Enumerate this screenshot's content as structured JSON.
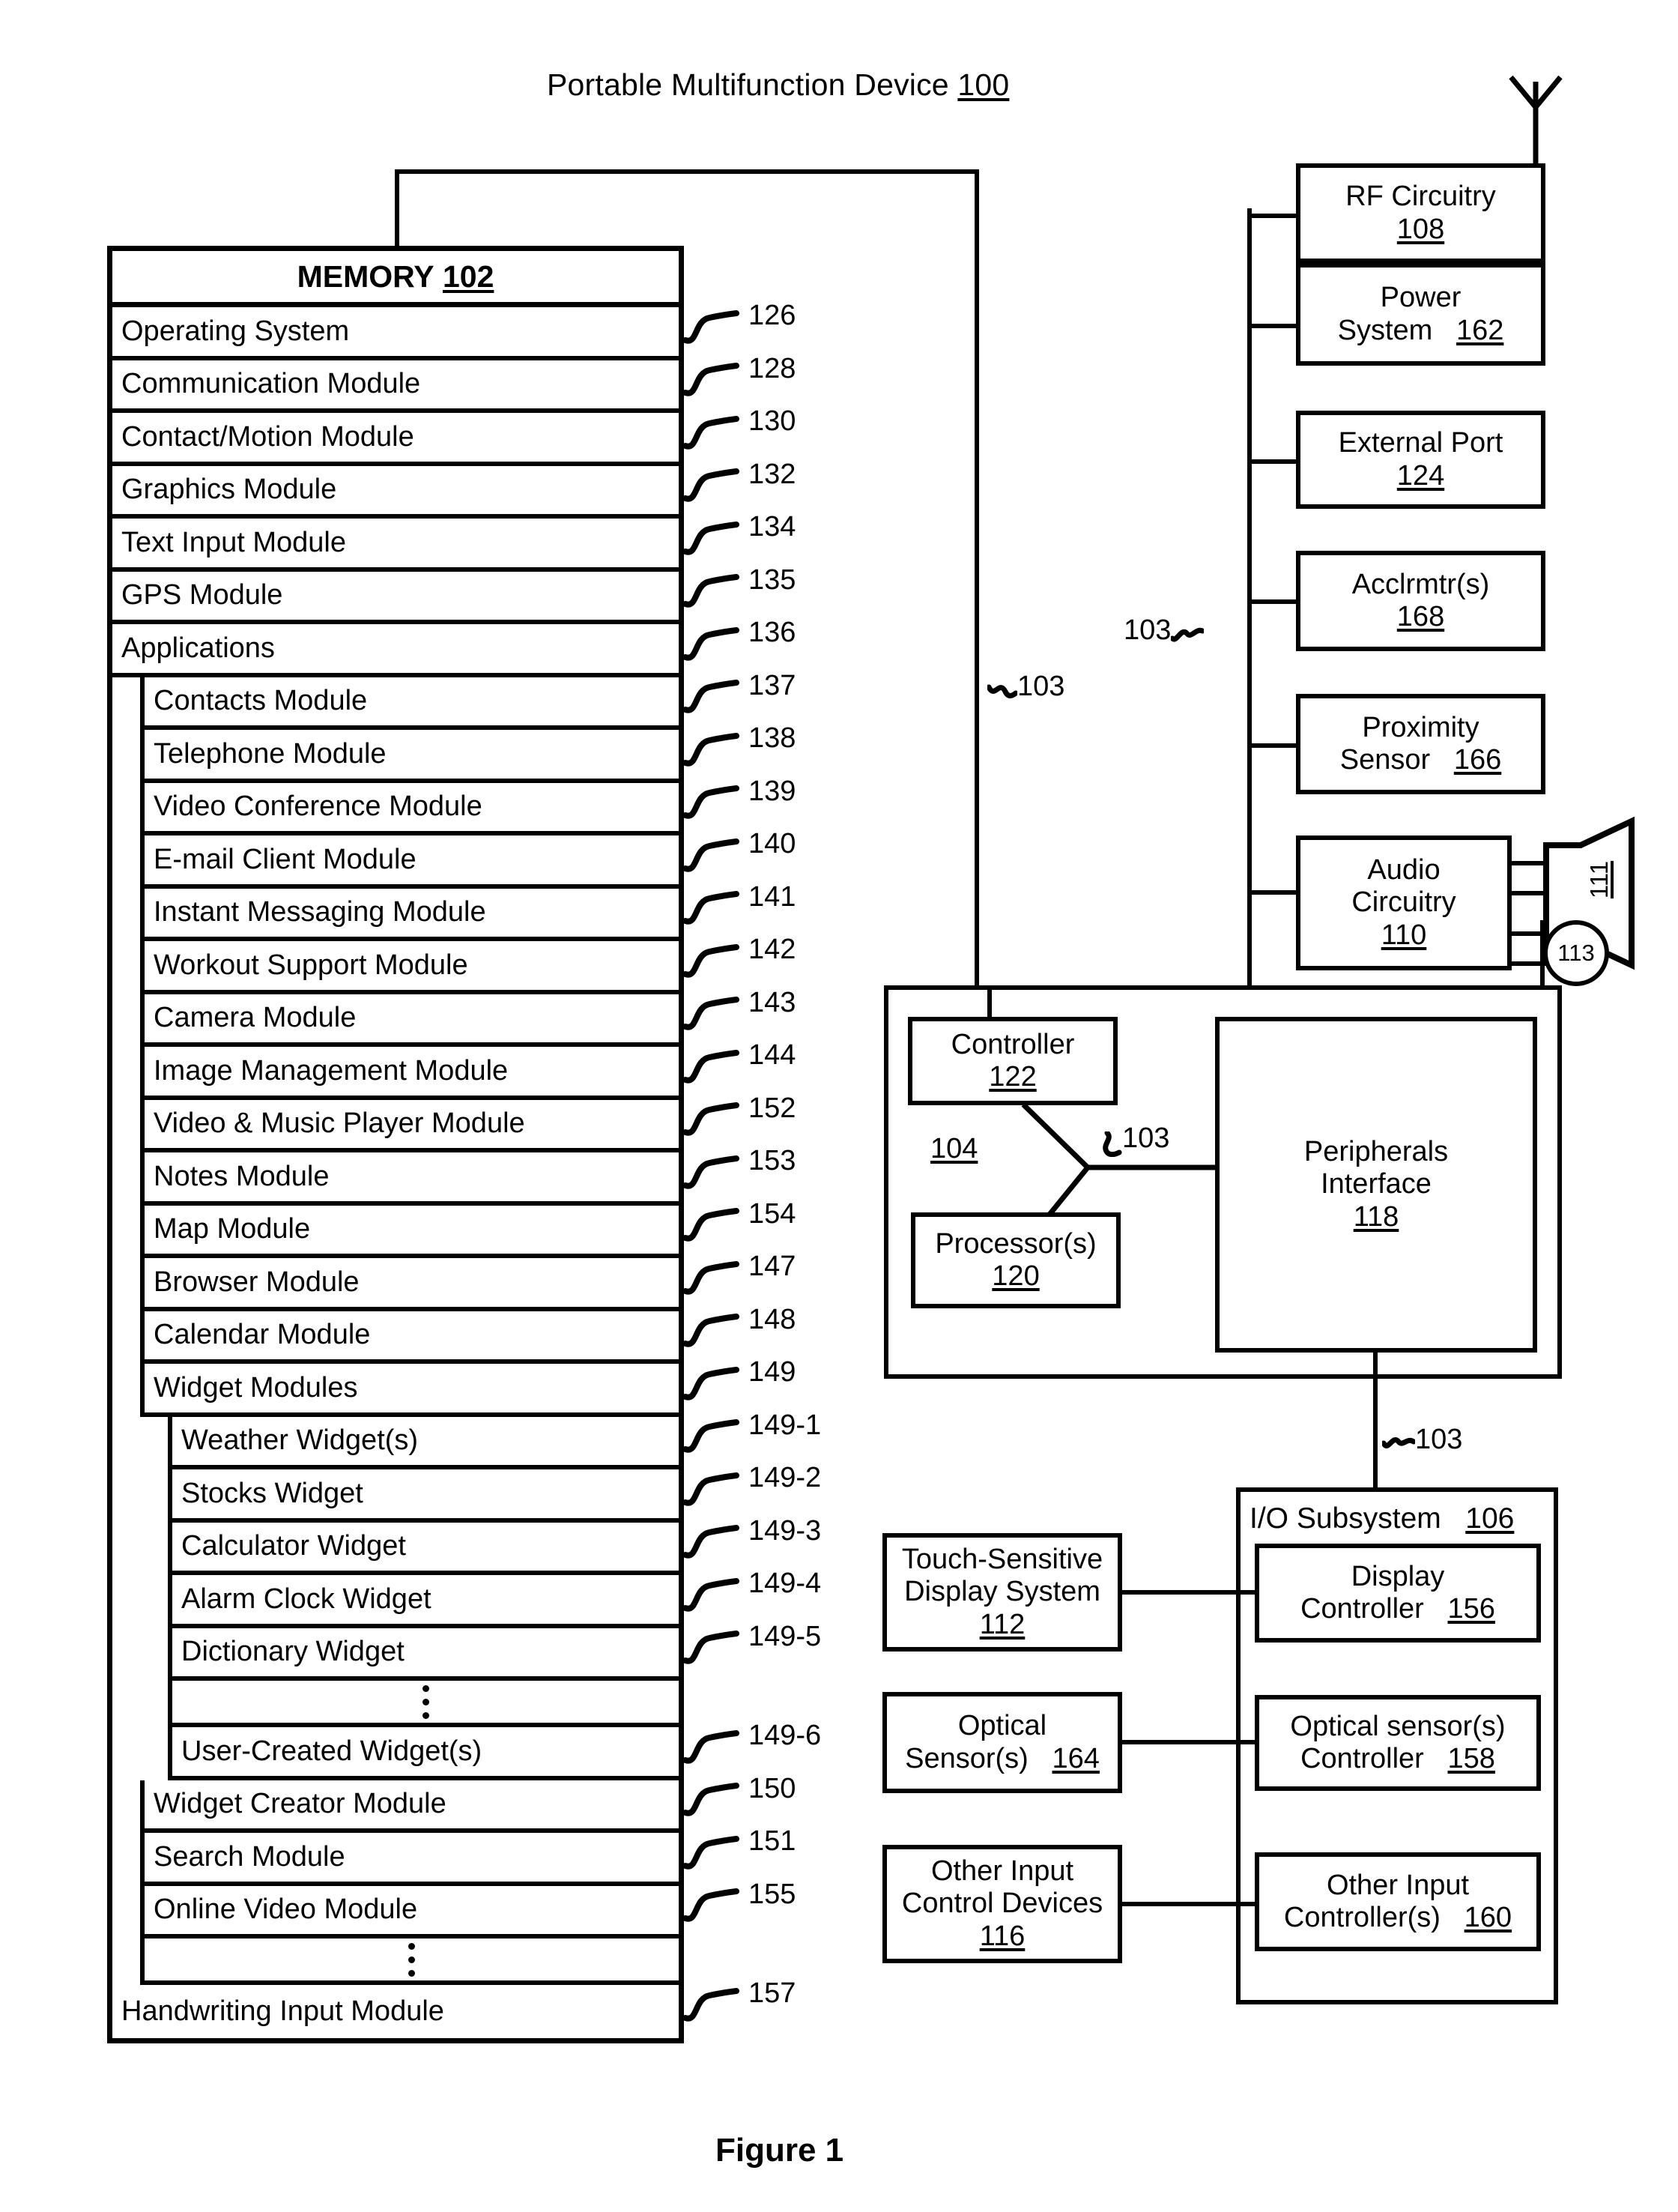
{
  "figure": {
    "title": "Portable Multifunction Device",
    "title_ref": "100",
    "caption": "Figure 1"
  },
  "memory": {
    "header_label": "MEMORY",
    "header_ref": "102",
    "rows": [
      {
        "label": "Operating System",
        "ref": "126",
        "indent": 0
      },
      {
        "label": "Communication Module",
        "ref": "128",
        "indent": 0
      },
      {
        "label": "Contact/Motion Module",
        "ref": "130",
        "indent": 0
      },
      {
        "label": "Graphics Module",
        "ref": "132",
        "indent": 0
      },
      {
        "label": "Text Input Module",
        "ref": "134",
        "indent": 0
      },
      {
        "label": "GPS Module",
        "ref": "135",
        "indent": 0
      },
      {
        "label": "Applications",
        "ref": "136",
        "indent": 0
      },
      {
        "label": "Contacts Module",
        "ref": "137",
        "indent": 1
      },
      {
        "label": "Telephone Module",
        "ref": "138",
        "indent": 1
      },
      {
        "label": "Video Conference Module",
        "ref": "139",
        "indent": 1
      },
      {
        "label": "E-mail Client Module",
        "ref": "140",
        "indent": 1
      },
      {
        "label": "Instant Messaging Module",
        "ref": "141",
        "indent": 1
      },
      {
        "label": "Workout Support Module",
        "ref": "142",
        "indent": 1
      },
      {
        "label": "Camera Module",
        "ref": "143",
        "indent": 1
      },
      {
        "label": "Image Management Module",
        "ref": "144",
        "indent": 1
      },
      {
        "label": "Video & Music Player Module",
        "ref": "152",
        "indent": 1
      },
      {
        "label": "Notes Module",
        "ref": "153",
        "indent": 1
      },
      {
        "label": "Map Module",
        "ref": "154",
        "indent": 1
      },
      {
        "label": "Browser Module",
        "ref": "147",
        "indent": 1
      },
      {
        "label": "Calendar Module",
        "ref": "148",
        "indent": 1
      },
      {
        "label": "Widget Modules",
        "ref": "149",
        "indent": 1
      },
      {
        "label": "Weather Widget(s)",
        "ref": "149-1",
        "indent": 2
      },
      {
        "label": "Stocks Widget",
        "ref": "149-2",
        "indent": 2
      },
      {
        "label": "Calculator Widget",
        "ref": "149-3",
        "indent": 2
      },
      {
        "label": "Alarm Clock Widget",
        "ref": "149-4",
        "indent": 2
      },
      {
        "label": "Dictionary Widget",
        "ref": "149-5",
        "indent": 2
      },
      {
        "label": "",
        "ref": "",
        "indent": 2,
        "dots": true
      },
      {
        "label": "User-Created Widget(s)",
        "ref": "149-6",
        "indent": 2
      },
      {
        "label": "Widget Creator Module",
        "ref": "150",
        "indent": 1
      },
      {
        "label": "Search Module",
        "ref": "151",
        "indent": 1
      },
      {
        "label": "Online Video Module",
        "ref": "155",
        "indent": 1
      },
      {
        "label": "",
        "ref": "",
        "indent": 1,
        "dots": true
      },
      {
        "label": "Handwriting Input Module",
        "ref": "157",
        "indent": 0
      }
    ]
  },
  "right_column": {
    "rf_circuitry": {
      "label": "RF Circuitry",
      "ref": "108"
    },
    "power_system": {
      "label": "Power\nSystem",
      "label_line1": "Power",
      "label_line2": "System",
      "ref": "162"
    },
    "external_port": {
      "label": "External Port",
      "ref": "124"
    },
    "accelerometer": {
      "label": "Acclrmtr(s)",
      "ref": "168"
    },
    "proximity": {
      "label_line1": "Proximity",
      "label_line2": "Sensor",
      "ref": "166"
    },
    "audio": {
      "label_line1": "Audio",
      "label_line2": "Circuitry",
      "ref": "110"
    },
    "speaker_ref": "111",
    "microphone_ref": "113"
  },
  "core": {
    "controller": {
      "label": "Controller",
      "ref": "122"
    },
    "processor": {
      "label": "Processor(s)",
      "ref": "120"
    },
    "peripherals": {
      "label_line1": "Peripherals",
      "label_line2": "Interface",
      "ref": "118"
    },
    "cpu_group_ref": "104",
    "bus_refs": [
      "103",
      "103",
      "103",
      "103"
    ]
  },
  "io_subsystem": {
    "title": "I/O Subsystem",
    "title_ref": "106",
    "bus_ref": "103",
    "left_boxes": [
      {
        "line1": "Touch-Sensitive",
        "line2": "Display System",
        "ref": "112",
        "ref_inline": false
      },
      {
        "line1": "Optical",
        "line2": "Sensor(s)",
        "ref": "164",
        "ref_inline": true
      },
      {
        "line1": "Other Input",
        "line2": "Control Devices",
        "ref": "116",
        "ref_inline": false
      }
    ],
    "right_boxes": [
      {
        "line1": "Display",
        "line2": "Controller",
        "ref": "156",
        "ref_inline": true
      },
      {
        "line1": "Optical sensor(s)",
        "line2": "Controller",
        "ref": "158",
        "ref_inline": true
      },
      {
        "line1": "Other Input",
        "line2": "Controller(s)",
        "ref": "160",
        "ref_inline": true
      }
    ]
  }
}
